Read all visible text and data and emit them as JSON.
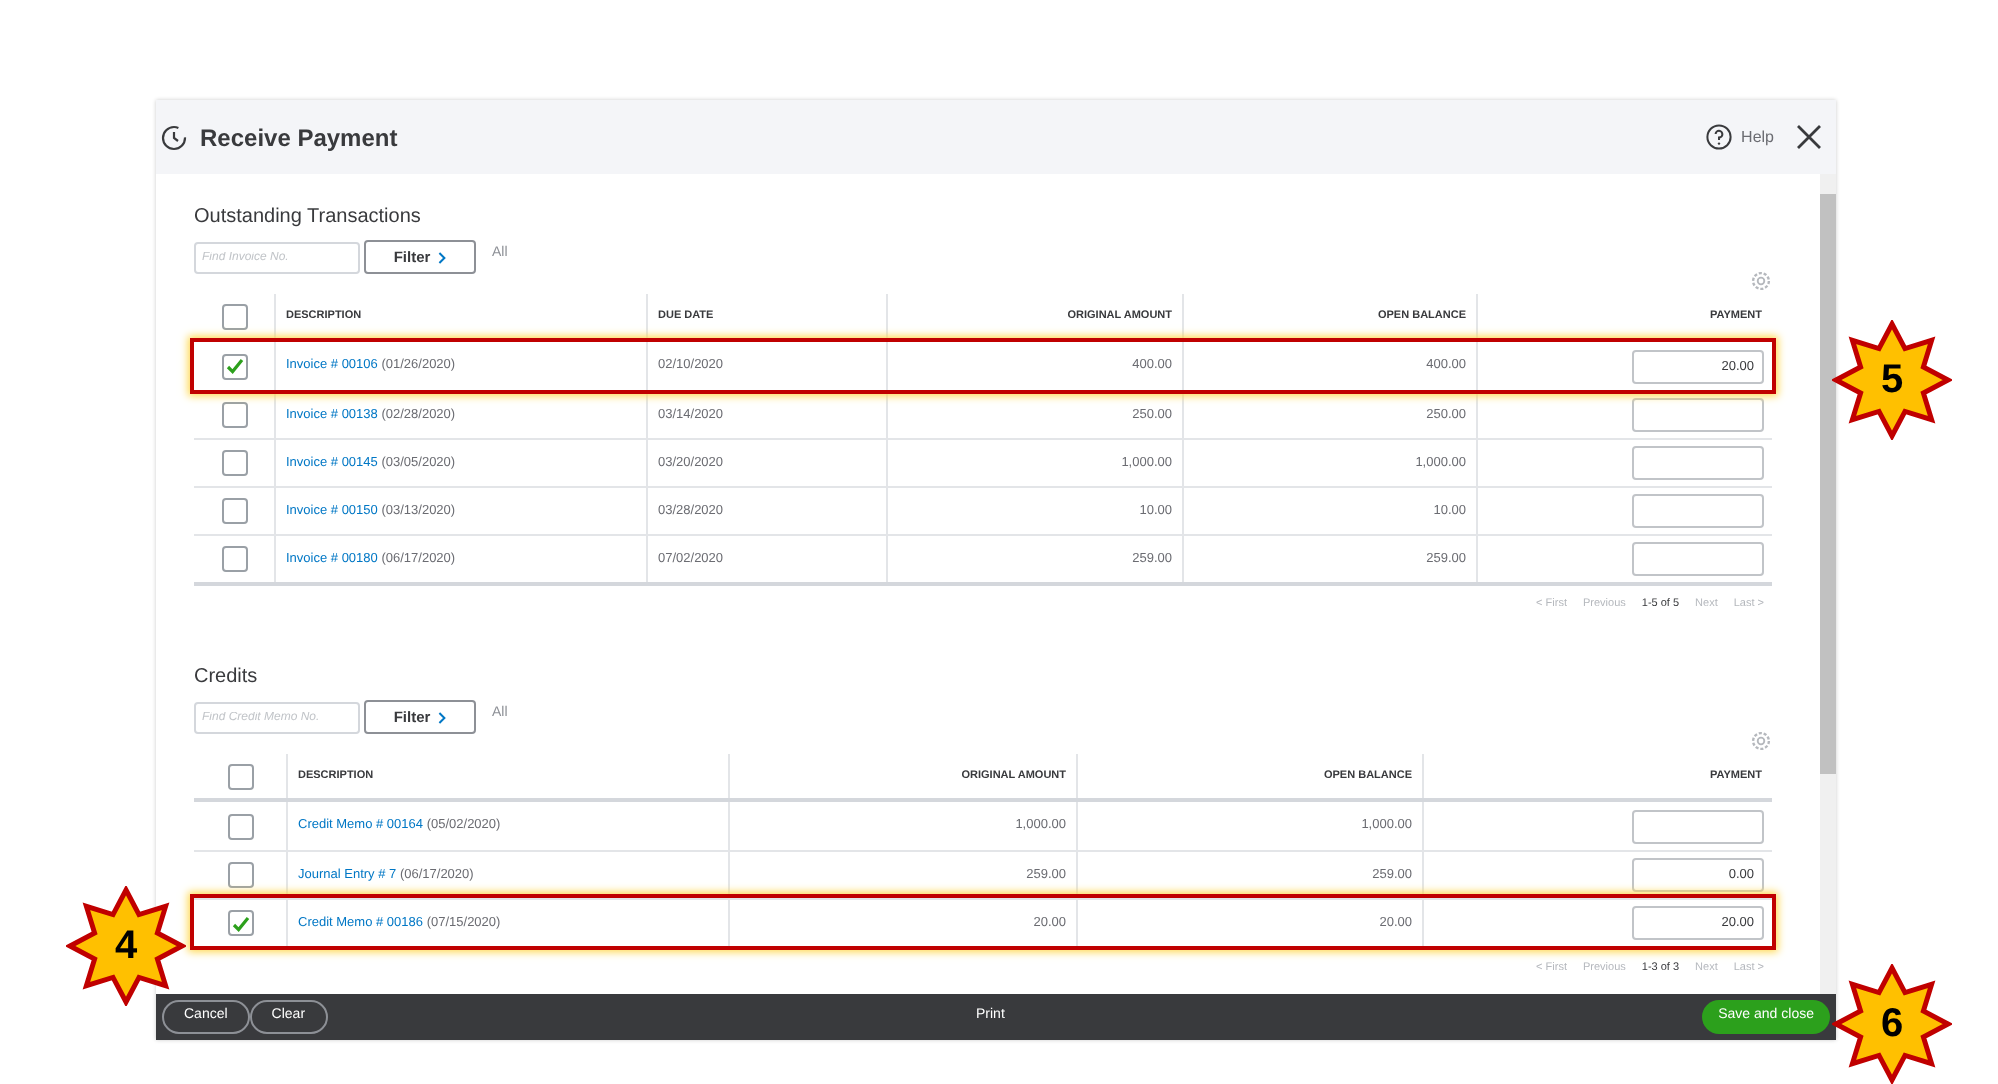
{
  "window": {
    "title": "Receive Payment",
    "help": "Help"
  },
  "sections": [
    {
      "title": "Outstanding Transactions",
      "search_placeholder": "Find Invoice No.",
      "filter": "Filter",
      "filter_value": "All",
      "pagination": [
        "< First",
        "Previous",
        "1-5 of 5",
        "Next",
        "Last >"
      ],
      "select_all": {
        "checked": false
      },
      "columns": [
        "DESCRIPTION",
        "DUE DATE",
        "ORIGINAL AMOUNT",
        "OPEN BALANCE",
        "PAYMENT"
      ],
      "rows": [
        {
          "checked": true,
          "highlighted": true,
          "cells": [
            {
              "link": "Invoice # 00106",
              "date": "(01/26/2020)"
            },
            "02/10/2020",
            "400.00",
            "400.00"
          ],
          "payment": "20.00"
        },
        {
          "checked": false,
          "highlighted": false,
          "cells": [
            {
              "link": "Invoice # 00138",
              "date": "(02/28/2020)"
            },
            "03/14/2020",
            "250.00",
            "250.00"
          ]
        },
        {
          "checked": false,
          "highlighted": false,
          "cells": [
            {
              "link": "Invoice # 00145",
              "date": "(03/05/2020)"
            },
            "03/20/2020",
            "1,000.00",
            "1,000.00"
          ]
        },
        {
          "checked": false,
          "highlighted": false,
          "cells": [
            {
              "link": "Invoice # 00150",
              "date": "(03/13/2020)"
            },
            "03/28/2020",
            "10.00",
            "10.00"
          ]
        },
        {
          "checked": false,
          "highlighted": false,
          "cells": [
            {
              "link": "Invoice # 00180",
              "date": "(06/17/2020)"
            },
            "07/02/2020",
            "259.00",
            "259.00"
          ]
        }
      ]
    },
    {
      "title": "Credits",
      "search_placeholder": "Find Credit Memo No.",
      "filter": "Filter",
      "filter_value": "All",
      "pagination": [
        "< First",
        "Previous",
        "1-3 of 3",
        "Next",
        "Last >"
      ],
      "select_all": {
        "checked": false
      },
      "columns": [
        "DESCRIPTION",
        "ORIGINAL AMOUNT",
        "OPEN BALANCE",
        "PAYMENT"
      ],
      "rows": [
        {
          "checked": false,
          "highlighted": false,
          "cells": [
            {
              "link": "Credit Memo # 00164",
              "date": "(05/02/2020)"
            },
            "1,000.00",
            "1,000.00"
          ]
        },
        {
          "checked": false,
          "highlighted": false,
          "cells": [
            {
              "link": "Journal Entry # 7",
              "date": "(06/17/2020)"
            },
            "259.00",
            "259.00"
          ],
          "payment": "0.00"
        },
        {
          "checked": true,
          "highlighted": true,
          "cells": [
            {
              "link": "Credit Memo # 00186",
              "date": "(07/15/2020)"
            },
            "20.00",
            "20.00"
          ],
          "payment": "20.00"
        }
      ]
    }
  ],
  "footer": {
    "cancel": "Cancel",
    "clear": "Clear",
    "print": "Print",
    "save": "Save and close"
  },
  "callouts": [
    {
      "number": "5"
    },
    {
      "number": "4"
    },
    {
      "number": "6"
    }
  ]
}
